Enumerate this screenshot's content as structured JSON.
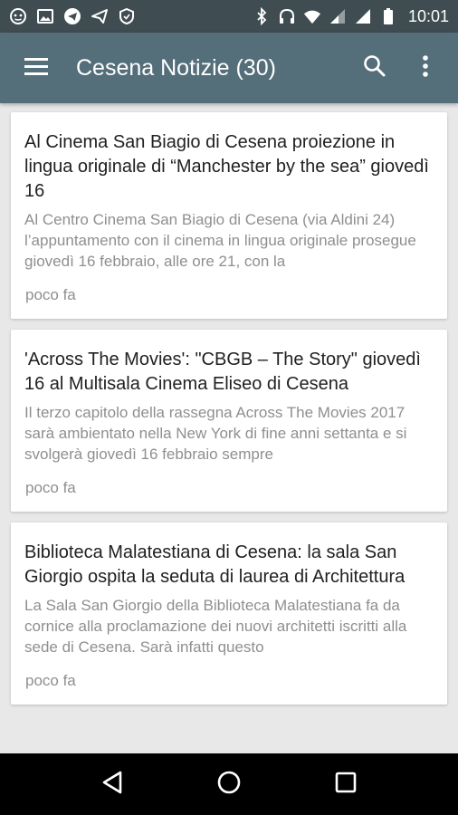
{
  "status_bar": {
    "time": "10:01",
    "icons": [
      "bug-icon",
      "image-icon",
      "telegram-icon",
      "send-icon",
      "shield-icon",
      "bluetooth-icon",
      "headphones-icon",
      "wifi-icon",
      "signal-icon",
      "signal-icon",
      "battery-icon"
    ]
  },
  "app_bar": {
    "title": "Cesena Notizie (30)",
    "icons": {
      "menu": "menu-icon",
      "search": "search-icon",
      "overflow": "more-vert-icon"
    }
  },
  "articles": [
    {
      "title": "Al Cinema San Biagio di Cesena proiezione in lingua originale di “Manchester by the sea” giovedì 16",
      "excerpt": "Al Centro Cinema San Biagio di Cesena (via Aldini 24) l’appuntamento con il cinema in lingua originale prosegue giovedì 16 febbraio, alle ore 21, con la",
      "time": "poco fa"
    },
    {
      "title": "'Across The Movies': \"CBGB – The Story\" giovedì 16 al Multisala Cinema Eliseo di Cesena",
      "excerpt": "Il terzo capitolo della rassegna Across The Movies 2017 sarà ambientato nella New York di fine anni settanta e si svolgerà giovedì 16 febbraio sempre",
      "time": "poco fa"
    },
    {
      "title": "Biblioteca Malatestiana di Cesena: la sala San Giorgio ospita la seduta di laurea di Architettura",
      "excerpt": "La Sala San Giorgio della Biblioteca Malatestiana fa da cornice alla proclamazione dei nuovi architetti iscritti alla sede di Cesena. Sarà infatti questo",
      "time": "poco fa"
    }
  ],
  "nav_bar": {
    "icons": [
      "back-icon",
      "home-icon",
      "recents-icon"
    ]
  },
  "colors": {
    "status_bar": "#3f4d53",
    "app_bar": "#546e7a",
    "background": "#e8e8e8",
    "card": "#ffffff",
    "title_text": "#212121",
    "secondary_text": "#8f8f8f"
  }
}
